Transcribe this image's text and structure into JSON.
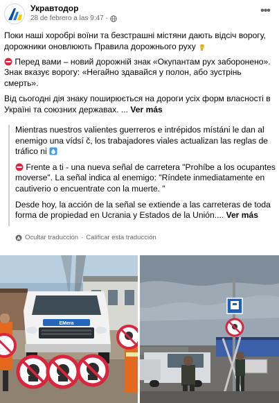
{
  "post": {
    "page_name": "Укравтодор",
    "date": "28 de febrero a las 9:47",
    "separator": "·",
    "more_label": "•••",
    "paragraphs": [
      "Поки наші хоробрі воїни та безстрашні містяни дають відсіч ворогу, дорожники оновлюють Правила дорожнього руху",
      "Перед вами – новий дорожній знак «Окупантам рух заборонено». Знак вказує ворогу: «Негайно здавайся у полон, або зустрінь смерть».",
      "Від сьогодні дія знаку поширюється на дороги усіх форм власності в Україні та союзних державах. ..."
    ],
    "see_more": "Ver más"
  },
  "translation": {
    "paragraphs": [
      "Mientras nuestros valientes guerreros e intrépidos místáni le dan al enemigo una vídsí č, los trabajadores viales actualizan las reglas de tráfico ni",
      "Frente a ti - una nueva señal de carretera \"Prohíbe a los ocupantes moverse\". La señal indica al enemigo: \"Ríndete inmediatamente en cautiverio o encuentrate con la muerte. \"",
      "Desde hoy, la acción de la señal se extiende a las carreteras de toda forma de propiedad en Ucrania y Estados de la Unión...."
    ],
    "see_more": "Ver más",
    "hide_label": "Ocultar traducción",
    "rate_label": "Calificar esta traducción",
    "dot": "·"
  },
  "photos": {
    "left_van_badge": "EMera"
  },
  "colors": {
    "brand_blue": "#1877f2",
    "secondary_text": "#65676b",
    "sign_red": "#d7263d"
  }
}
